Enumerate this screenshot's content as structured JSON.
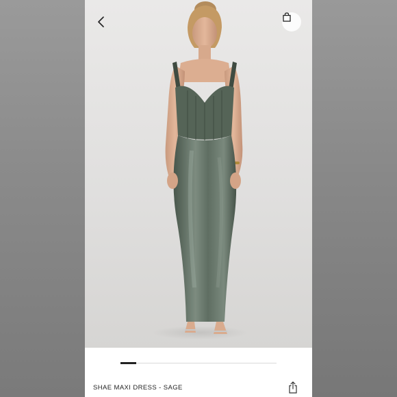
{
  "product": {
    "title": "SHAE MAXI DRESS - SAGE",
    "image_subject": "model wearing sage satin corset maxi dress"
  },
  "gallery": {
    "progress_fraction": 0.1
  },
  "icons": {
    "back": "chevron-left-icon",
    "bag": "shopping-bag-icon",
    "share": "share-icon"
  },
  "colors": {
    "dress": "#5c6b5f",
    "background": "#e4e3e2"
  }
}
